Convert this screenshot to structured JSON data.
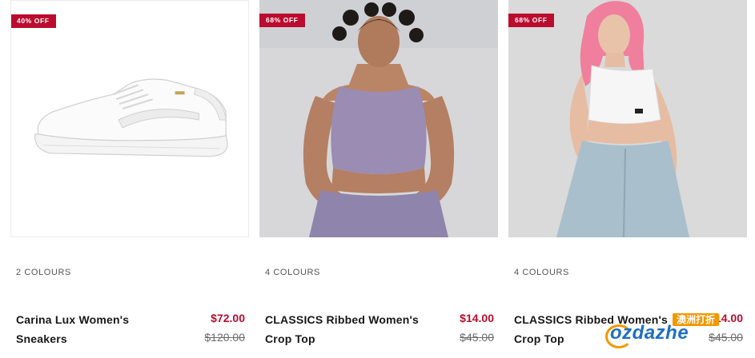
{
  "products": [
    {
      "badge": "40% OFF",
      "colours": "2 COLOURS",
      "name": "Carina Lux Women's Sneakers",
      "sale_price": "$72.00",
      "original_price": "$120.00",
      "image": "white-sneaker"
    },
    {
      "badge": "68% OFF",
      "colours": "4 COLOURS",
      "name": "CLASSICS Ribbed Women's Crop Top",
      "sale_price": "$14.00",
      "original_price": "$45.00",
      "image": "model-purple-crop-top"
    },
    {
      "badge": "68% OFF",
      "colours": "4 COLOURS",
      "name": "CLASSICS Ribbed Women's Crop Top",
      "sale_price": "$14.00",
      "original_price": "$45.00",
      "image": "model-white-crop-top"
    }
  ],
  "watermark": {
    "top_text": "澳洲打折",
    "main_text": "ozdazhe"
  },
  "colors": {
    "sale_red": "#ba0c2f",
    "badge_red": "#ba0c2f",
    "text_dark": "#181818",
    "text_muted": "#6b6b6b"
  }
}
